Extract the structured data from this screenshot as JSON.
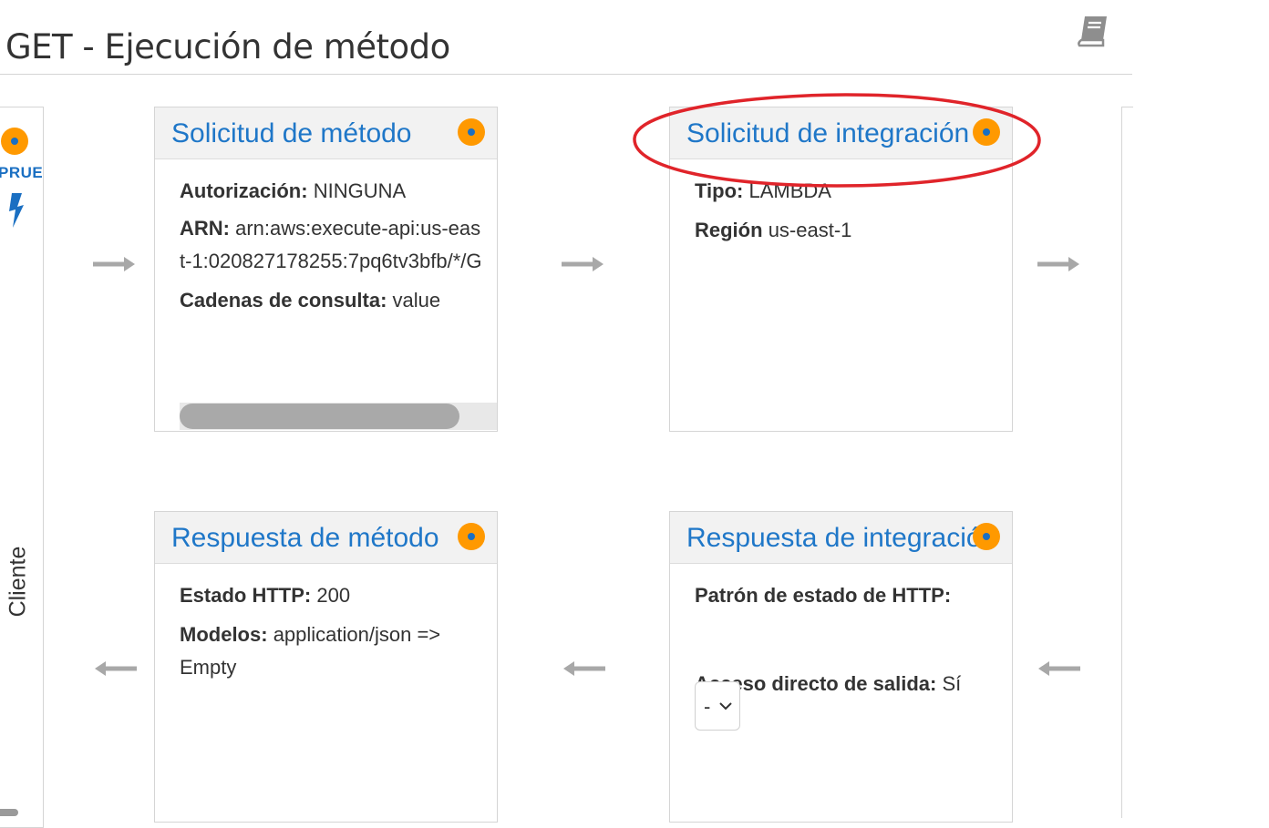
{
  "page": {
    "title": "GET - Ejecución de método"
  },
  "client": {
    "label": "Cliente",
    "test_label": "PRUEBA"
  },
  "method_request": {
    "title": "Solicitud de método",
    "auth_label": "Autorización:",
    "auth_value": "NINGUNA",
    "arn_label": "ARN:",
    "arn_value": "arn:aws:execute-api:us-east-1:020827178255:7pq6tv3bfb/*/G",
    "query_label": "Cadenas de consulta:",
    "query_value": "value"
  },
  "integration_request": {
    "title": "Solicitud de integración",
    "type_label": "Tipo:",
    "type_value": "LAMBDA",
    "region_label": "Región",
    "region_value": "us-east-1"
  },
  "method_response": {
    "title": "Respuesta de método",
    "status_label": "Estado HTTP:",
    "status_value": "200",
    "models_label": "Modelos:",
    "models_value": "application/json => Empty"
  },
  "integration_response": {
    "title": "Respuesta de integración",
    "pattern_label": "Patrón de estado de HTTP:",
    "pattern_value": "-",
    "passthrough_label": "Acceso directo de salida:",
    "passthrough_value": "Sí"
  },
  "colors": {
    "accent": "#1f77c8",
    "dot_orange": "#ff9900",
    "highlight_red": "#e0242a",
    "arrow_gray": "#a8a8a8"
  },
  "icons": {
    "docs": "book-icon",
    "test": "lightning-icon",
    "arrows": "arrow-icon"
  }
}
